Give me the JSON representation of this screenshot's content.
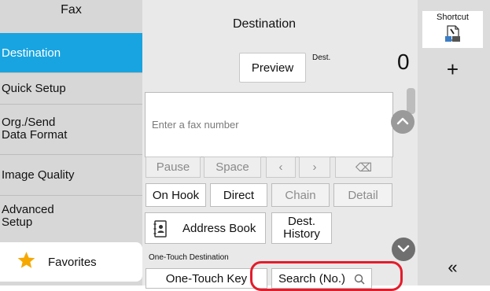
{
  "left_menu": {
    "header": "Fax",
    "items": [
      {
        "label": "Destination"
      },
      {
        "label": "Quick Setup"
      },
      {
        "label": "Org./Send",
        "label2": "Data Format"
      },
      {
        "label": "Image Quality"
      },
      {
        "label": "Advanced",
        "label2": "Setup"
      }
    ],
    "favorites_label": "Favorites"
  },
  "center": {
    "title": "Destination",
    "preview_label": "Preview",
    "dest_label": "Dest.",
    "dest_count": "0",
    "input_placeholder": "Enter a fax number",
    "keys": [
      "Pause",
      "Space",
      "‹",
      "›",
      "⌫"
    ],
    "actions": [
      "On Hook",
      "Direct",
      "Chain",
      "Detail"
    ],
    "address_book_label": "Address Book",
    "dest_history_label": [
      "Dest.",
      "History"
    ],
    "onetouch_section_label": "One-Touch Destination",
    "onetouch_key_label": "One-Touch Key",
    "search_no_label": "Search (No.)"
  },
  "right_panel": {
    "shortcut_label": "Shortcut",
    "plus_symbol": "+",
    "collapse_symbol": "«"
  },
  "colors": {
    "active_menu": "#18a4e0",
    "highlight_ring": "#e31c2b",
    "favorites_star": "#f6a800"
  }
}
